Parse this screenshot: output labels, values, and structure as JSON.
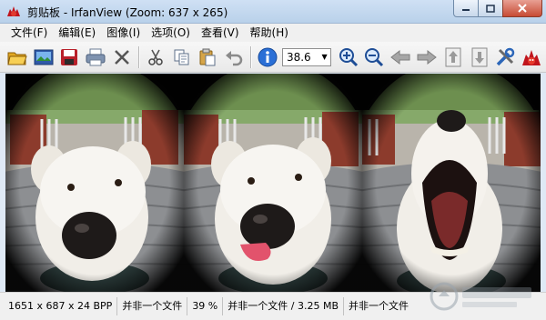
{
  "window": {
    "title": "剪贴板 - IrfanView (Zoom: 637 x 265)",
    "app_icon": "irfanview-cat-icon",
    "controls": [
      "minimize-icon",
      "maximize-icon",
      "close-icon"
    ]
  },
  "menu": {
    "items": [
      {
        "label": "文件(F)"
      },
      {
        "label": "编辑(E)"
      },
      {
        "label": "图像(I)"
      },
      {
        "label": "选项(O)"
      },
      {
        "label": "查看(V)"
      },
      {
        "label": "帮助(H)"
      }
    ]
  },
  "toolbar": {
    "icons": [
      "open-folder-icon",
      "thumbnails-icon",
      "save-icon",
      "print-icon",
      "delete-icon",
      "cut-icon",
      "copy-icon",
      "paste-icon",
      "undo-icon",
      "info-icon",
      "zoom-in-icon",
      "zoom-out-icon",
      "previous-icon",
      "next-icon",
      "move-up-icon",
      "move-down-icon",
      "settings-icon",
      "irfanview-cat-icon"
    ],
    "zoom_value": "38.6"
  },
  "status": {
    "dimensions": "1651 x 687 x 24 BPP",
    "file1": "并非一个文件",
    "zoom": "39 %",
    "file_size": "并非一个文件 / 3.25 MB",
    "file2": "并非一个文件"
  },
  "colors": {
    "title_bar": "#c6daf1",
    "close_button": "#c74b34",
    "canvas_bg": "#0b0b0b",
    "info_blue": "#2a6fd6"
  }
}
